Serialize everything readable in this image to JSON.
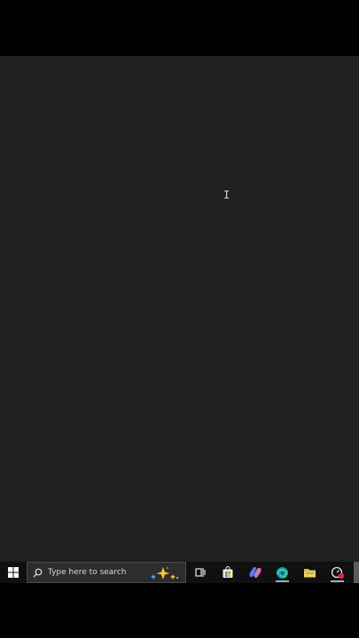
{
  "taskbar": {
    "search_placeholder": "Type here to search",
    "items": [
      {
        "name": "task-view",
        "icon": "task-view-icon"
      },
      {
        "name": "microsoft-store",
        "icon": "store-bag-icon"
      },
      {
        "name": "copilot",
        "icon": "copilot-icon"
      },
      {
        "name": "edge",
        "icon": "edge-icon"
      },
      {
        "name": "file-explorer",
        "icon": "folder-icon"
      },
      {
        "name": "screen-recorder",
        "icon": "recorder-icon"
      }
    ]
  },
  "colors": {
    "desktop_bg": "#202020",
    "taskbar_bg": "#101010",
    "search_bg": "#2d2d2d",
    "accent": "#8fb2d6"
  }
}
